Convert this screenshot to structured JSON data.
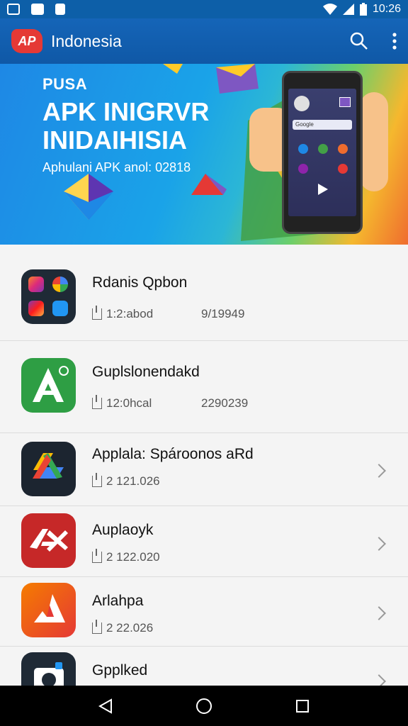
{
  "status": {
    "time": "10:26"
  },
  "app": {
    "logo_text": "AP",
    "title": "Indonesia"
  },
  "banner": {
    "line1": "PUSA",
    "line2": "APK INIGRVR",
    "line3": "INIDAIHISIA",
    "line4": "Aphulani APK anol: 02818",
    "phone_search": "Google"
  },
  "apps": [
    {
      "name": "Rdanis Qpbon",
      "size": "1:2:abod",
      "date": "9/19949"
    },
    {
      "name": "Guplslonendakd",
      "size": "12:0hcal",
      "date": "2290239"
    },
    {
      "name": "Applala: Spároonos aRd",
      "size": "2 121.026"
    },
    {
      "name": "Auplaoyk",
      "size": "2 122.020"
    },
    {
      "name": "Arlahpa",
      "size": "2 22.026"
    },
    {
      "name": "Gpplked",
      "size": ""
    }
  ],
  "colors": {
    "app_bar": "#1565b8",
    "status_bar": "#0d5fa8",
    "nav_bar": "#000000"
  }
}
